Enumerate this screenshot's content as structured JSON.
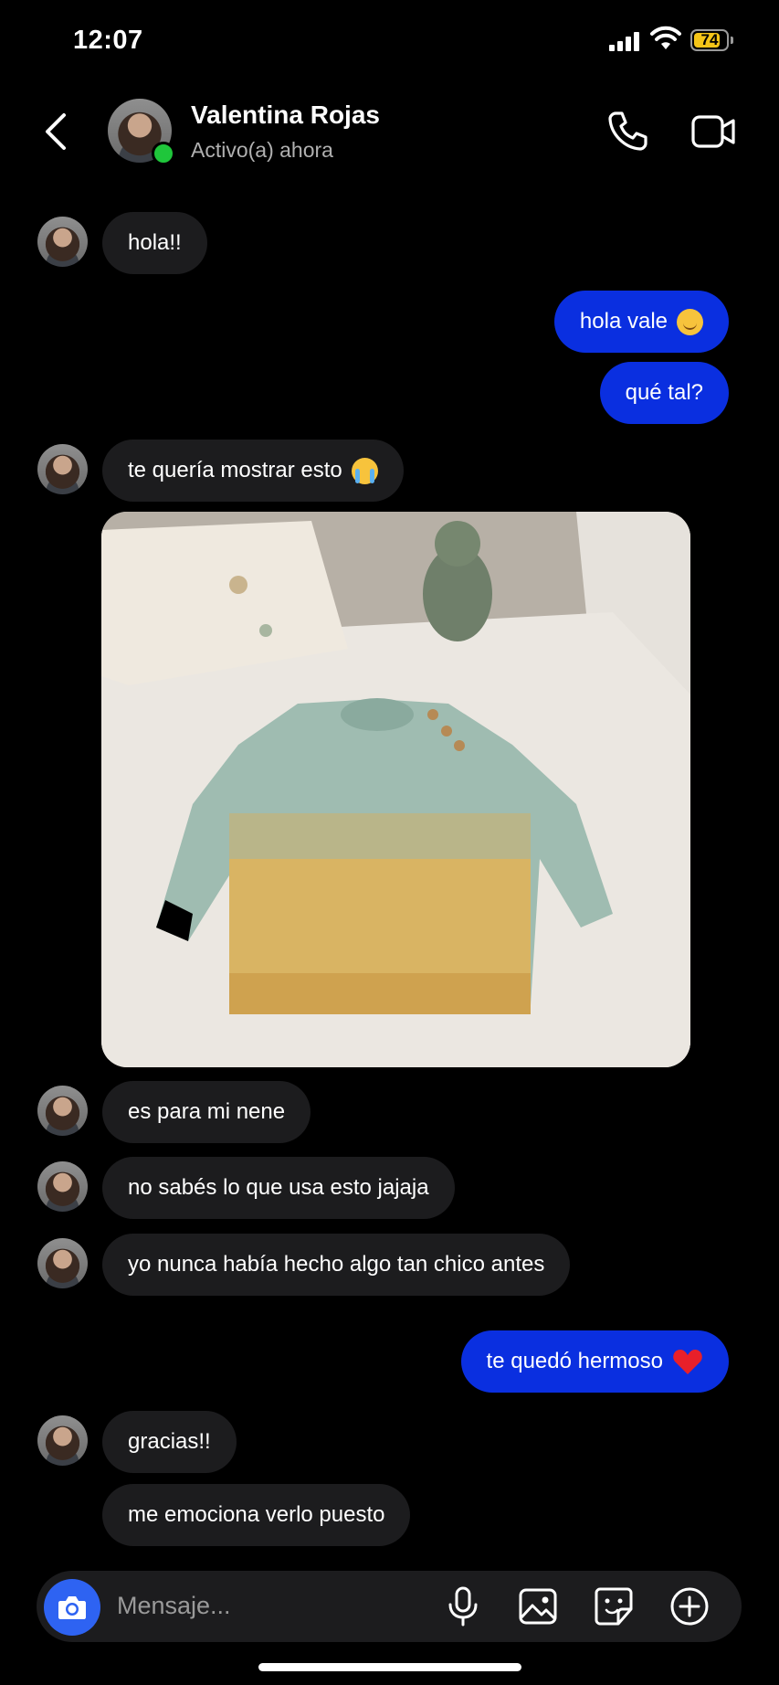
{
  "status_bar": {
    "time": "12:07",
    "battery": "74"
  },
  "header": {
    "contact_name": "Valentina Rojas",
    "status": "Activo(a) ahora",
    "online_color": "#1fc63b",
    "icons": [
      "back-icon",
      "phone-icon",
      "video-icon"
    ]
  },
  "messages": {
    "m1": "hola!!",
    "m2": "hola vale",
    "m3": "qué tal?",
    "m4": "te quería mostrar esto",
    "m5": "es para mi nene",
    "m6": "no sabés lo que usa esto jajaja",
    "m7": "yo nunca había hecho algo tan chico antes",
    "m8": "te quedó hermoso",
    "m9": "gracias!!",
    "m10": "me emociona verlo puesto"
  },
  "composer": {
    "placeholder": "Mensaje..."
  },
  "colors": {
    "outgoing_bubble": "#0a2fe0",
    "incoming_bubble": "#1c1c1e",
    "camera_button": "#2e63f2"
  }
}
